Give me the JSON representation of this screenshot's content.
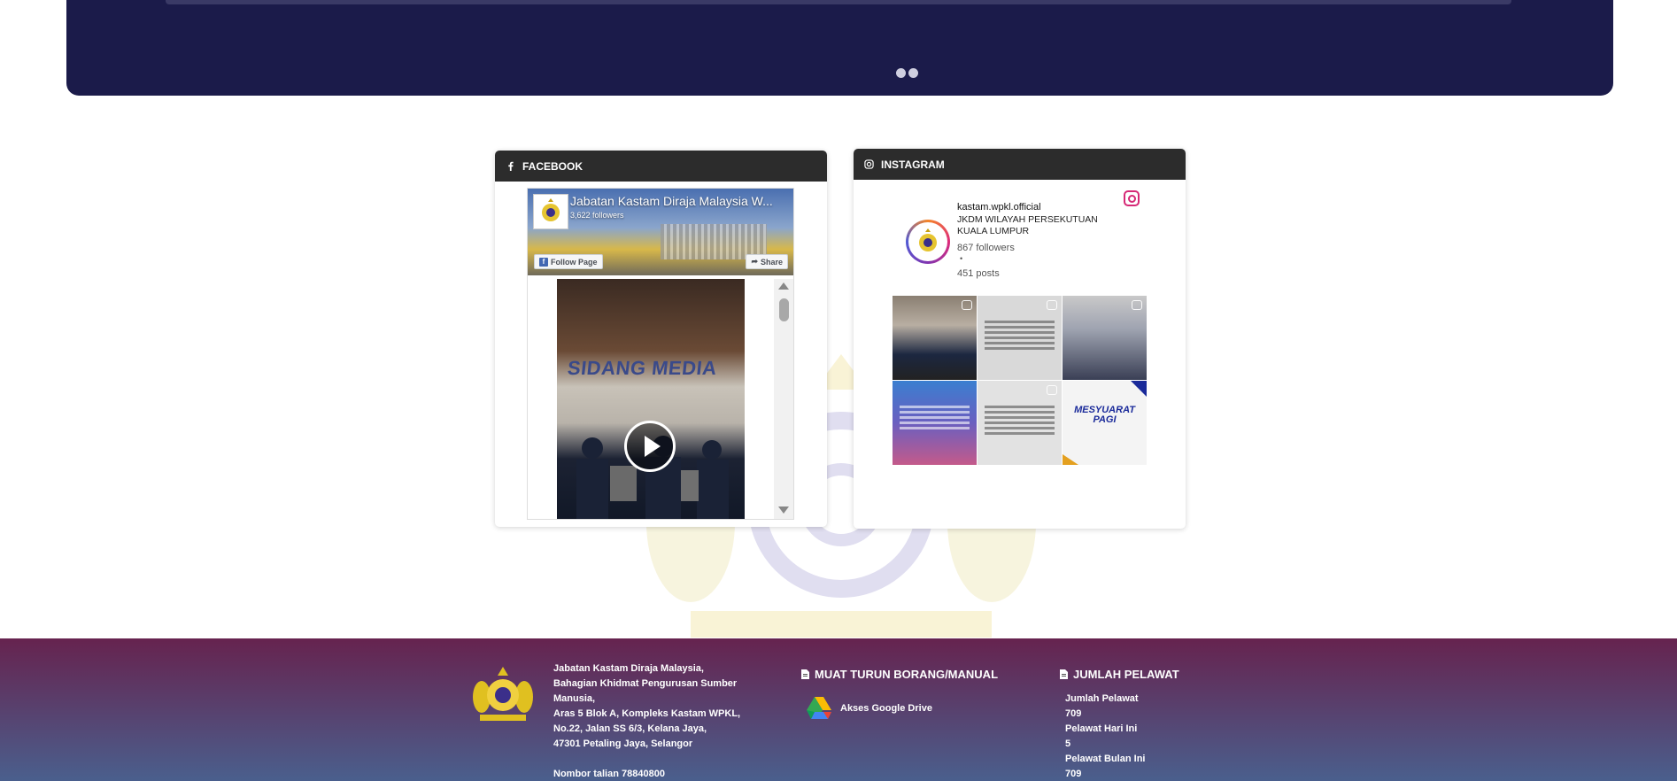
{
  "banner": {
    "slide_dots": 2
  },
  "facebook": {
    "section_title": "FACEBOOK",
    "page_name": "Jabatan Kastam Diraja Malaysia W...",
    "followers": "3,622 followers",
    "follow_label": "Follow Page",
    "share_label": "Share",
    "video_overlay_text": "SIDANG MEDIA"
  },
  "instagram": {
    "section_title": "INSTAGRAM",
    "username": "kastam.wpkl.official",
    "display_name": "JKDM WILAYAH PERSEKUTUAN KUALA LUMPUR",
    "followers": "867 followers",
    "separator": "•",
    "posts": "451 posts",
    "tile6_text": "MESYUARAT PAGI"
  },
  "footer": {
    "address_lines": [
      "Jabatan Kastam Diraja Malaysia,",
      "Bahagian Khidmat Pengurusan Sumber Manusia,",
      "Aras 5 Blok A, Kompleks Kastam WPKL,",
      "No.22, Jalan SS 6/3, Kelana Jaya,",
      "47301 Petaling Jaya, Selangor"
    ],
    "phone": "Nombor talian 78840800",
    "downloads_heading": "MUAT TURUN BORANG/MANUAL",
    "gdrive_label": "Akses Google Drive",
    "visitors_heading": "JUMLAH PELAWAT",
    "visitors": {
      "total_label": "Jumlah Pelawat",
      "total_value": "709",
      "today_label": "Pelawat Hari Ini",
      "today_value": "5",
      "month_label": "Pelawat Bulan Ini",
      "month_value": "709"
    }
  },
  "colors": {
    "banner": "#1b1b4a",
    "card_header": "#2c2c2c",
    "footer_top": "#66234f",
    "footer_bottom": "#4a5f8d",
    "facebook_blue": "#4267b2",
    "instagram_pink": "#d62976"
  }
}
